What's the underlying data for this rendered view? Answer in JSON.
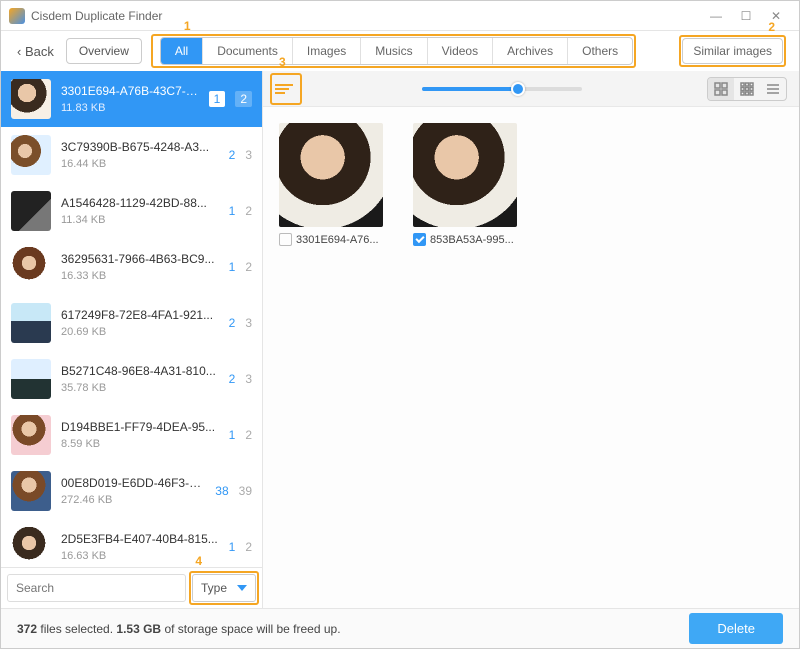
{
  "window": {
    "title": "Cisdem Duplicate Finder",
    "back": "‹ Back",
    "overview": "Overview",
    "similar": "Similar images"
  },
  "tabs": [
    "All",
    "Documents",
    "Images",
    "Musics",
    "Videos",
    "Archives",
    "Others"
  ],
  "sidebar": {
    "items": [
      {
        "name": "3301E694-A76B-43C7-B8...",
        "size": "11.83 KB",
        "a": "1",
        "b": "2"
      },
      {
        "name": "3C79390B-B675-4248-A3...",
        "size": "16.44 KB",
        "a": "2",
        "b": "3"
      },
      {
        "name": "A1546428-1129-42BD-88...",
        "size": "11.34 KB",
        "a": "1",
        "b": "2"
      },
      {
        "name": "36295631-7966-4B63-BC9...",
        "size": "16.33 KB",
        "a": "1",
        "b": "2"
      },
      {
        "name": "617249F8-72E8-4FA1-921...",
        "size": "20.69 KB",
        "a": "2",
        "b": "3"
      },
      {
        "name": "B5271C48-96E8-4A31-810...",
        "size": "35.78 KB",
        "a": "2",
        "b": "3"
      },
      {
        "name": "D194BBE1-FF79-4DEA-95...",
        "size": "8.59 KB",
        "a": "1",
        "b": "2"
      },
      {
        "name": "00E8D019-E6DD-46F3-9E...",
        "size": "272.46 KB",
        "a": "38",
        "b": "39"
      },
      {
        "name": "2D5E3FB4-E407-40B4-815...",
        "size": "16.63 KB",
        "a": "1",
        "b": "2"
      }
    ],
    "search_placeholder": "Search",
    "type_label": "Type"
  },
  "preview": {
    "items": [
      {
        "name": "3301E694-A76...",
        "checked": false
      },
      {
        "name": "853BA53A-995...",
        "checked": true
      }
    ]
  },
  "status": {
    "count": "372",
    "mid": " files selected. ",
    "size": "1.53 GB",
    "tail": " of storage space will be freed up.",
    "delete": "Delete"
  },
  "annotations": {
    "a1": "1",
    "a2": "2",
    "a3": "3",
    "a4": "4"
  }
}
